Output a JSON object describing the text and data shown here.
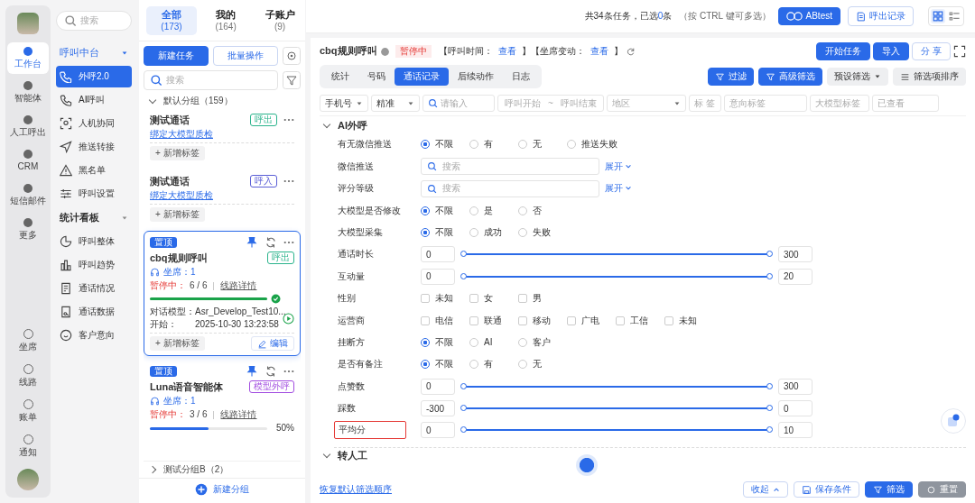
{
  "rail": {
    "top": [
      {
        "label": "工作台",
        "selected": true
      },
      {
        "label": "智能体",
        "selected": false
      },
      {
        "label": "人工呼出",
        "selected": false
      },
      {
        "label": "CRM",
        "selected": false
      },
      {
        "label": "短信邮件",
        "selected": false
      },
      {
        "label": "更多",
        "selected": false
      }
    ],
    "bottom": [
      {
        "label": "坐席"
      },
      {
        "label": "线路"
      },
      {
        "label": "账单"
      },
      {
        "label": "通知"
      }
    ]
  },
  "nav": {
    "search": {
      "placeholder": "搜索"
    },
    "groups": [
      {
        "title": "呼叫中台",
        "items": [
          {
            "label": "外呼2.0",
            "selected": true
          },
          {
            "label": "AI呼叫",
            "selected": false
          },
          {
            "label": "人机协同",
            "selected": false
          },
          {
            "label": "推送转接",
            "selected": false
          },
          {
            "label": "黑名单",
            "selected": false
          },
          {
            "label": "呼叫设置",
            "selected": false
          }
        ]
      },
      {
        "title": "统计看板",
        "items": [
          {
            "label": "呼叫整体",
            "selected": false
          },
          {
            "label": "呼叫趋势",
            "selected": false
          },
          {
            "label": "通话情况",
            "selected": false
          },
          {
            "label": "通话数据",
            "selected": false
          },
          {
            "label": "客户意向",
            "selected": false
          }
        ]
      }
    ]
  },
  "tasks": {
    "tabs": [
      {
        "label": "全部",
        "count": "(173)",
        "selected": true
      },
      {
        "label": "我的",
        "count": "(164)",
        "selected": false
      },
      {
        "label": "子账户",
        "count": "(9)",
        "selected": false
      }
    ],
    "new_task": "新建任务",
    "batch": "批量操作",
    "search": {
      "placeholder": "搜索"
    },
    "group": "默认分组（159）",
    "cards": [
      {
        "title": "测试通话",
        "tag": "呼出",
        "color": "#2bb48c",
        "link": "绑定大模型质检",
        "add_tag": "+ 新增标签",
        "selected": false
      },
      {
        "title": "测试通话",
        "tag": "呼入",
        "color": "#5b5fd6",
        "link": "绑定大模型质检",
        "add_tag": "+ 新增标签",
        "selected": false
      },
      {
        "pinned": "置顶",
        "title": "cbq规则呼叫",
        "tag": "呼出",
        "color": "#2bb48c",
        "agents": "坐席：1",
        "status": "暂停中：",
        "progress": "6 / 6",
        "line": "线路详情",
        "level": 1,
        "done": true,
        "model_label": "对话模型：",
        "model": "Asr_Develop_Test10...",
        "start_label": "开始：",
        "start": "2025-10-30 13:23:58",
        "add_tag": "+ 新增标签",
        "edit": "编辑",
        "selected": true
      },
      {
        "pinned": "置顶",
        "title": "Luna语音智能体",
        "tag": "模型外呼",
        "color": "#a24de0",
        "agents": "坐席：1",
        "status": "暂停中：",
        "progress": "3 / 6",
        "line": "线路详情",
        "level": 0.5,
        "done": false,
        "percent": "50%",
        "selected": false
      }
    ],
    "group_b": "测试分组B（2）",
    "new_group": "新建分组"
  },
  "top": {
    "summary": "共34条任务，已选",
    "selected_count": "0",
    "unit": "条",
    "hint": "（按 CTRL 键可多选）",
    "abtest": "ABtest",
    "records": "呼出记录",
    "views": [
      {
        "selected": true
      },
      {
        "selected": false
      }
    ]
  },
  "header": {
    "title": "cbq规则呼叫",
    "status": "暂停中",
    "parts": [
      {
        "text": "【呼叫时间：",
        "link": false
      },
      {
        "text": "查看",
        "link": true
      },
      {
        "text": "】【坐席变动：",
        "link": false
      },
      {
        "text": "查看",
        "link": true
      },
      {
        "text": "】",
        "link": false
      }
    ],
    "buttons": [
      {
        "label": "开始任务",
        "primary": true
      },
      {
        "label": "导入",
        "primary": true
      },
      {
        "label": "分 享",
        "primary": false
      }
    ]
  },
  "tabs": [
    {
      "label": "统计",
      "selected": false
    },
    {
      "label": "号码",
      "selected": false
    },
    {
      "label": "通话记录",
      "selected": true
    },
    {
      "label": "后续动作",
      "selected": false
    },
    {
      "label": "日志",
      "selected": false
    }
  ],
  "tools": [
    {
      "label": "过滤",
      "primary": true
    },
    {
      "label": "高级筛选",
      "primary": true
    },
    {
      "label": "预设筛选",
      "primary": false
    },
    {
      "label": "筛选项排序",
      "primary": false
    }
  ],
  "filterbar": {
    "phone": "手机号",
    "mode": "精准",
    "placeholder": "请输入",
    "start": "呼叫开始",
    "tilde": "~",
    "end": "呼叫结束",
    "region": "地区",
    "tag": "标 签",
    "intent": "意向标签",
    "model_tag": "大模型标签",
    "viewed": "已查看"
  },
  "section": "AI外呼",
  "filters": [
    {
      "kind": "radio",
      "label": "有无微信推送",
      "options": [
        {
          "label": "不限",
          "selected": true
        },
        {
          "label": "有",
          "selected": false
        },
        {
          "label": "无",
          "selected": false
        },
        {
          "label": "推送失败",
          "selected": false
        }
      ]
    },
    {
      "kind": "search",
      "label": "微信推送",
      "placeholder": "搜索",
      "expand": "展开"
    },
    {
      "kind": "search",
      "label": "评分等级",
      "placeholder": "搜索",
      "expand": "展开"
    },
    {
      "kind": "radio",
      "label": "大模型是否修改",
      "options": [
        {
          "label": "不限",
          "selected": true
        },
        {
          "label": "是",
          "selected": false
        },
        {
          "label": "否",
          "selected": false
        }
      ]
    },
    {
      "kind": "radio",
      "label": "大模型采集",
      "options": [
        {
          "label": "不限",
          "selected": true
        },
        {
          "label": "成功",
          "selected": false
        },
        {
          "label": "失败",
          "selected": false
        }
      ]
    },
    {
      "kind": "range",
      "label": "通话时长",
      "min": "0",
      "max": "300",
      "level": 1
    },
    {
      "kind": "range",
      "label": "互动量",
      "min": "0",
      "max": "20",
      "level": 1
    },
    {
      "kind": "check",
      "label": "性别",
      "options": [
        {
          "label": "未知",
          "checked": false
        },
        {
          "label": "女",
          "checked": false
        },
        {
          "label": "男",
          "checked": false
        }
      ]
    },
    {
      "kind": "check",
      "label": "运营商",
      "options": [
        {
          "label": "电信",
          "checked": false
        },
        {
          "label": "联通",
          "checked": false
        },
        {
          "label": "移动",
          "checked": false
        },
        {
          "label": "广电",
          "checked": false
        },
        {
          "label": "工信",
          "checked": false
        },
        {
          "label": "未知",
          "checked": false
        }
      ]
    },
    {
      "kind": "radio",
      "label": "挂断方",
      "options": [
        {
          "label": "不限",
          "selected": true
        },
        {
          "label": "AI",
          "selected": false
        },
        {
          "label": "客户",
          "selected": false
        }
      ]
    },
    {
      "kind": "radio",
      "label": "是否有备注",
      "options": [
        {
          "label": "不限",
          "selected": true
        },
        {
          "label": "有",
          "selected": false
        },
        {
          "label": "无",
          "selected": false
        }
      ]
    },
    {
      "kind": "range",
      "label": "点赞数",
      "min": "0",
      "max": "300",
      "level": 1
    },
    {
      "kind": "range",
      "label": "踩数",
      "min": "-300",
      "max": "0",
      "level": 1
    },
    {
      "kind": "range",
      "label": "平均分",
      "min": "0",
      "max": "10",
      "level": 1,
      "highlighted": true
    }
  ],
  "section2": "转人工",
  "footer": {
    "reset_order": "恢复默认筛选顺序",
    "collapse": "收起",
    "save": "保存条件",
    "filter": "筛选",
    "reset": "重置"
  }
}
